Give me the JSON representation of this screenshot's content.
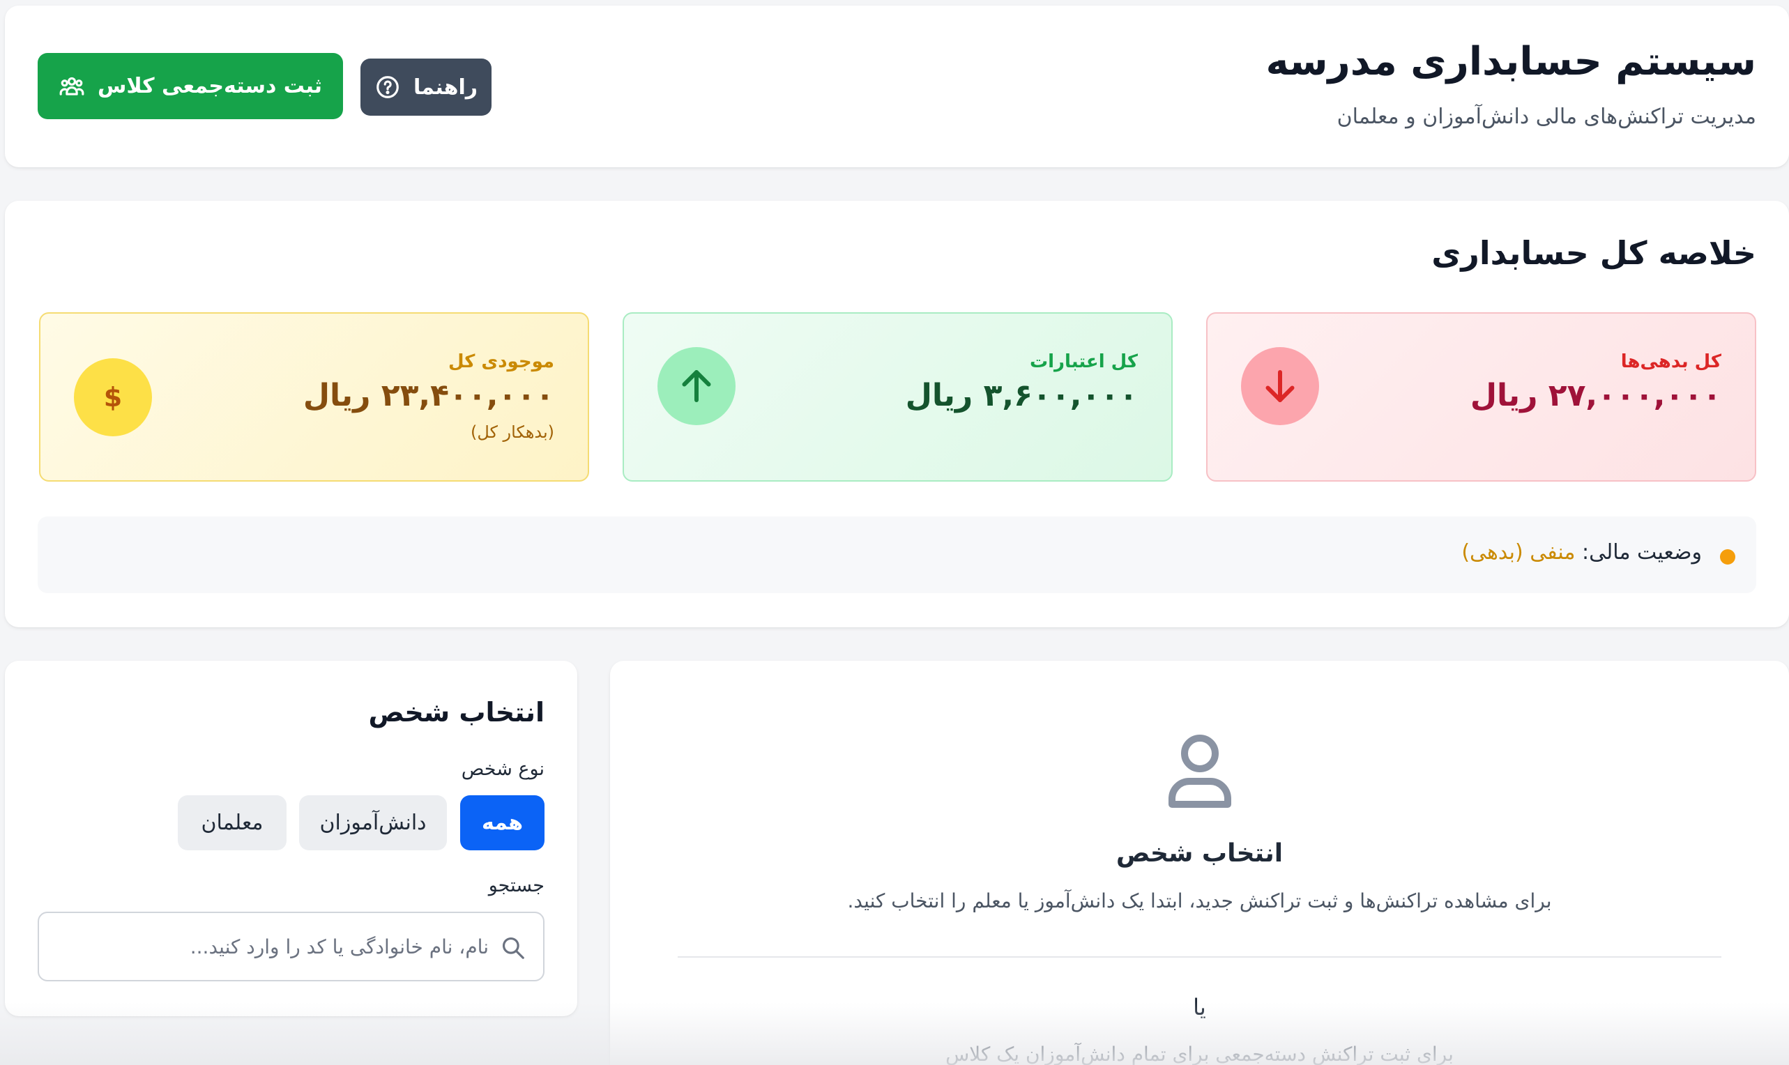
{
  "header": {
    "title": "سیستم حسابداری مدرسه",
    "subtitle": "مدیریت تراکنش‌های مالی دانش‌آموزان و معلمان",
    "help_label": "راهنما",
    "bulk_label": "ثبت دسته‌جمعی کلاس"
  },
  "summary": {
    "title": "خلاصه کل حسابداری",
    "debts": {
      "label": "کل بدهی‌ها",
      "value": "۲۷,۰۰۰,۰۰۰ ریال",
      "icon": "arrow-down-icon",
      "color": "#dc2626"
    },
    "credits": {
      "label": "کل اعتبارات",
      "value": "۳,۶۰۰,۰۰۰ ریال",
      "icon": "arrow-up-icon",
      "color": "#16a34a"
    },
    "balance": {
      "label": "موجودی کل",
      "value": "۲۳,۴۰۰,۰۰۰ ریال",
      "note": "(بدهکار کل)",
      "icon": "dollar-icon",
      "icon_glyph": "$",
      "color": "#ca8a04"
    },
    "status": {
      "label": "وضعیت مالی:",
      "value": "منفی (بدهی)",
      "color": "#f59e0b"
    }
  },
  "person_panel": {
    "title": "انتخاب شخص",
    "type_label": "نوع شخص",
    "filters": [
      "همه",
      "دانش‌آموزان",
      "معلمان"
    ],
    "active_filter": "همه",
    "search_label": "جستجو",
    "search_placeholder": "نام، نام خانوادگی یا کد را وارد کنید...",
    "search_value": ""
  },
  "empty_state": {
    "title": "انتخاب شخص",
    "description": "برای مشاهده تراکنش‌ها و ثبت تراکنش جدید، ابتدا یک دانش‌آموز یا معلم را انتخاب کنید.",
    "or_text": "یا",
    "bulk_description": "برای ثبت تراکنش دسته‌جمعی برای تمام دانش‌آموزان یک کلاس"
  }
}
